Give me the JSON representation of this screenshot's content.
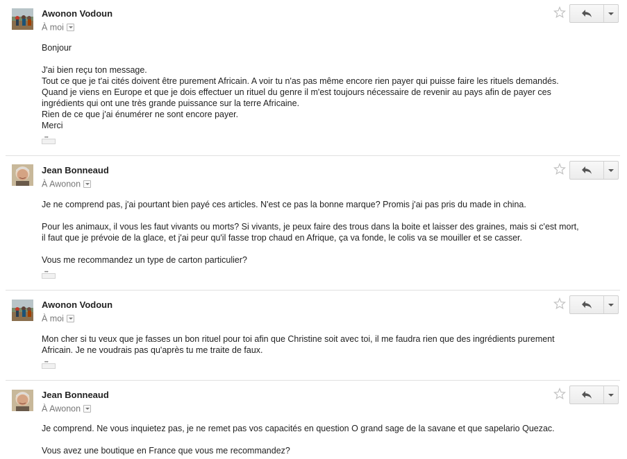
{
  "messages": [
    {
      "sender": "Awonon Vodoun",
      "recipient": "À moi",
      "lines": [
        "Bonjour",
        "",
        "J'ai bien reçu ton message.",
        "Tout ce que je t'ai cités doivent être purement Africain. A voir tu n'as pas même encore rien payer qui puisse faire les rituels demandés.",
        "Quand je viens en Europe et que je dois effectuer un rituel du genre il m'est toujours nécessaire de revenir au pays afin de payer ces",
        "ingrédients qui ont une très grande puissance sur la terre Africaine.",
        "Rien de ce que j'ai énumérer ne sont encore payer.",
        "Merci"
      ]
    },
    {
      "sender": "Jean Bonneaud",
      "recipient": "À Awonon",
      "lines": [
        "Je ne comprend pas, j'ai pourtant bien payé ces articles. N'est ce pas la bonne marque? Promis j'ai pas pris du made in china.",
        "",
        "Pour les animaux, il vous les faut vivants ou morts? Si vivants, je peux faire des trous dans la boite et laisser des graines, mais si c'est mort,",
        "il faut que je prévoie de la glace, et j'ai peur qu'il fasse trop chaud en Afrique, ça va fonde, le colis va se mouiller et se casser.",
        "",
        "Vous me recommandez un type de carton particulier?"
      ]
    },
    {
      "sender": "Awonon Vodoun",
      "recipient": "À moi",
      "lines": [
        "Mon cher si tu veux que je fasses un bon rituel pour toi afin que Christine soit avec toi, il me faudra rien que des ingrédients purement",
        "Africain. Je ne voudrais pas qu'après tu me traite de faux."
      ]
    },
    {
      "sender": "Jean Bonneaud",
      "recipient": "À Awonon",
      "lines": [
        "Je comprend. Ne vous inquietez pas, je ne remet pas vos capacités en question O grand sage de la savane et que sapelario Quezac.",
        "",
        "Vous avez une boutique en France que vous me recommandez?"
      ]
    }
  ]
}
